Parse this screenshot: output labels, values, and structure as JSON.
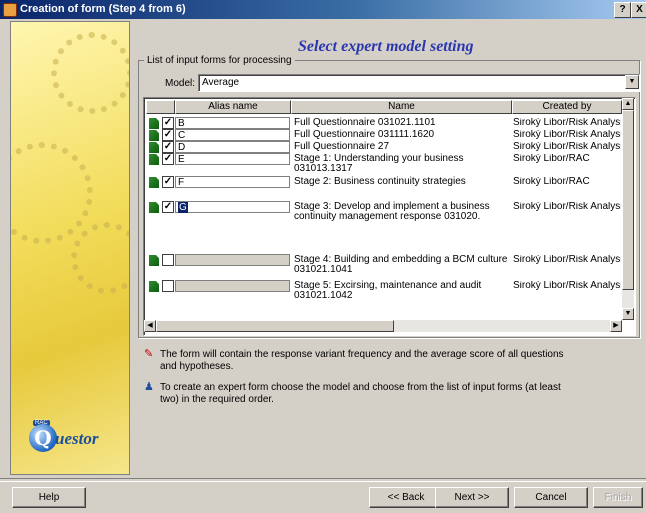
{
  "window": {
    "title": "Creation of form (Step 4 from 6)",
    "help_glyph": "?",
    "close_glyph": "X"
  },
  "logo": {
    "tag": "RAC",
    "letter": "Q",
    "text": "uestor"
  },
  "heading": "Select expert model setting",
  "group_label": "List of input forms for processing",
  "model": {
    "label": "Model:",
    "value": "Average"
  },
  "table": {
    "columns": [
      "Alias name",
      "Name",
      "Created by"
    ],
    "rows": [
      {
        "checked": true,
        "alias": "B",
        "name": "Full Questionnaire 031021.1101",
        "created_by": "Široký Libor/Risk Analysis C"
      },
      {
        "checked": true,
        "alias": "C",
        "name": "Full Questionnaire 031111.1620",
        "created_by": "Široký Libor/Risk Analysis C"
      },
      {
        "checked": true,
        "alias": "D",
        "name": "Full Questionnaire 27",
        "created_by": "Široký Libor/Risk Analysis C"
      },
      {
        "checked": true,
        "alias": "E",
        "name": "Stage 1: Understanding your business 031013.1317",
        "created_by": "Široký Libor/RAC"
      },
      {
        "checked": true,
        "alias": "F",
        "name": "Stage 2: Business continuity strategies",
        "created_by": "Široký Libor/RAC"
      },
      {
        "checked": true,
        "alias": "G",
        "name": "Stage 3: Develop and implement a business continuity management response 031020.",
        "created_by": "Široký Libor/Risk Analysis C",
        "selected": true
      },
      {
        "checked": false,
        "alias": "",
        "name": "Stage 4: Building and embedding a BCM culture 031021.1041",
        "created_by": "Široký Libor/Risk Analysis C"
      },
      {
        "checked": false,
        "alias": "",
        "name": "Stage 5: Excirsing, maintenance and audit 031021.1042",
        "created_by": "Široký Libor/Risk Analysis C"
      }
    ]
  },
  "info": {
    "line1": "The form will contain the response variant frequency and the average score of all questions and hypotheses.",
    "line2": "To create an expert form choose the model and choose from the list of input forms (at least two) in the required order."
  },
  "buttons": {
    "help": "Help",
    "back": "<< Back",
    "next": "Next >>",
    "cancel": "Cancel",
    "finish": "Finish"
  }
}
